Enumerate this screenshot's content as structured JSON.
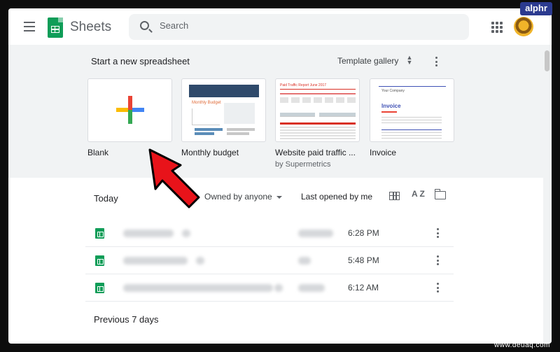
{
  "header": {
    "app_title": "Sheets",
    "search_placeholder": "Search"
  },
  "templates": {
    "start_label": "Start a new spreadsheet",
    "gallery_label": "Template gallery",
    "items": [
      {
        "name": "Blank",
        "subtitle": ""
      },
      {
        "name": "Monthly budget",
        "subtitle": ""
      },
      {
        "name": "Website paid traffic ...",
        "subtitle": "by Supermetrics"
      },
      {
        "name": "Invoice",
        "subtitle": ""
      }
    ],
    "thumb_text": {
      "budget_title": "Monthly Budget",
      "traffic_title": "Paid Traffic Report June 2017",
      "invoice_top": "Your Company",
      "invoice_title": "Invoice"
    }
  },
  "files": {
    "section_today": "Today",
    "owner_filter": "Owned by anyone",
    "sort_label": "Last opened by me",
    "sort_az": "A Z",
    "rows": [
      {
        "time": "6:28 PM"
      },
      {
        "time": "5:48 PM"
      },
      {
        "time": "6:12 AM"
      }
    ],
    "section_previous": "Previous 7 days"
  },
  "overlay": {
    "badge": "alphr",
    "watermark": "www.deuaq.com"
  },
  "colors": {
    "sheets_green": "#0f9d58",
    "arrow_red": "#e8131a",
    "badge_blue": "#2b3a8f"
  }
}
